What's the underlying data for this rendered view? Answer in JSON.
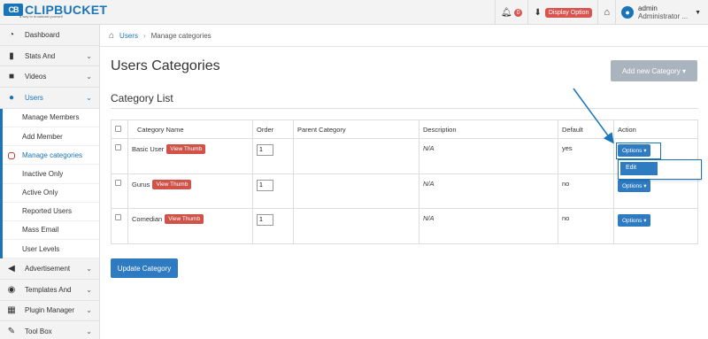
{
  "header": {
    "logo_mark": "CB",
    "logo_text": "CLIPBUCKET",
    "logo_tagline": "a way to broadcast yourself",
    "notifications_count": "0",
    "display_option_label": "Display Option",
    "user_name": "admin",
    "user_role": "Administrator ..."
  },
  "breadcrumb": {
    "link": "Users",
    "separator": "›",
    "current": "Manage categories"
  },
  "sidebar": {
    "items": [
      {
        "label": "Dashboard",
        "icon": "dashboard-icon"
      },
      {
        "label": "Stats And",
        "icon": "bar-chart-icon"
      },
      {
        "label": "Videos",
        "icon": "video-camera-icon"
      },
      {
        "label": "Users",
        "icon": "user-icon"
      },
      {
        "label": "Advertisement",
        "icon": "bullhorn-icon"
      },
      {
        "label": "Templates And",
        "icon": "circle-dot-icon"
      },
      {
        "label": "Plugin Manager",
        "icon": "plugin-icon"
      },
      {
        "label": "Tool Box",
        "icon": "wrench-icon"
      }
    ],
    "users_submenu": [
      "Manage Members",
      "Add Member",
      "Manage categories",
      "Inactive Only",
      "Active Only",
      "Reported Users",
      "Mass Email",
      "User Levels"
    ]
  },
  "main": {
    "title": "Users Categories",
    "add_button": "Add new Category ▾",
    "section_title": "Category List",
    "update_button": "Update Category"
  },
  "table": {
    "headers": [
      "Category Name",
      "Order",
      "Parent Category",
      "Description",
      "Default",
      "Action"
    ],
    "rows": [
      {
        "name": "Basic User",
        "badge": "View Thumb",
        "order": "1",
        "parent": "",
        "description": "N/A",
        "default": "yes",
        "action": "Options ▾"
      },
      {
        "name": "Gurus",
        "badge": "View Thumb",
        "order": "1",
        "parent": "",
        "description": "N/A",
        "default": "no",
        "action": "Options ▾"
      },
      {
        "name": "Comedian",
        "badge": "View Thumb",
        "order": "1",
        "parent": "",
        "description": "N/A",
        "default": "no",
        "action": "Options ▾"
      }
    ]
  },
  "dropdown": {
    "edit_label": "Edit"
  },
  "colors": {
    "brand_blue": "#1a74b8",
    "button_blue": "#2f7bc2",
    "badge_red": "#d0534a",
    "disabled_gray": "#a9b4be"
  }
}
